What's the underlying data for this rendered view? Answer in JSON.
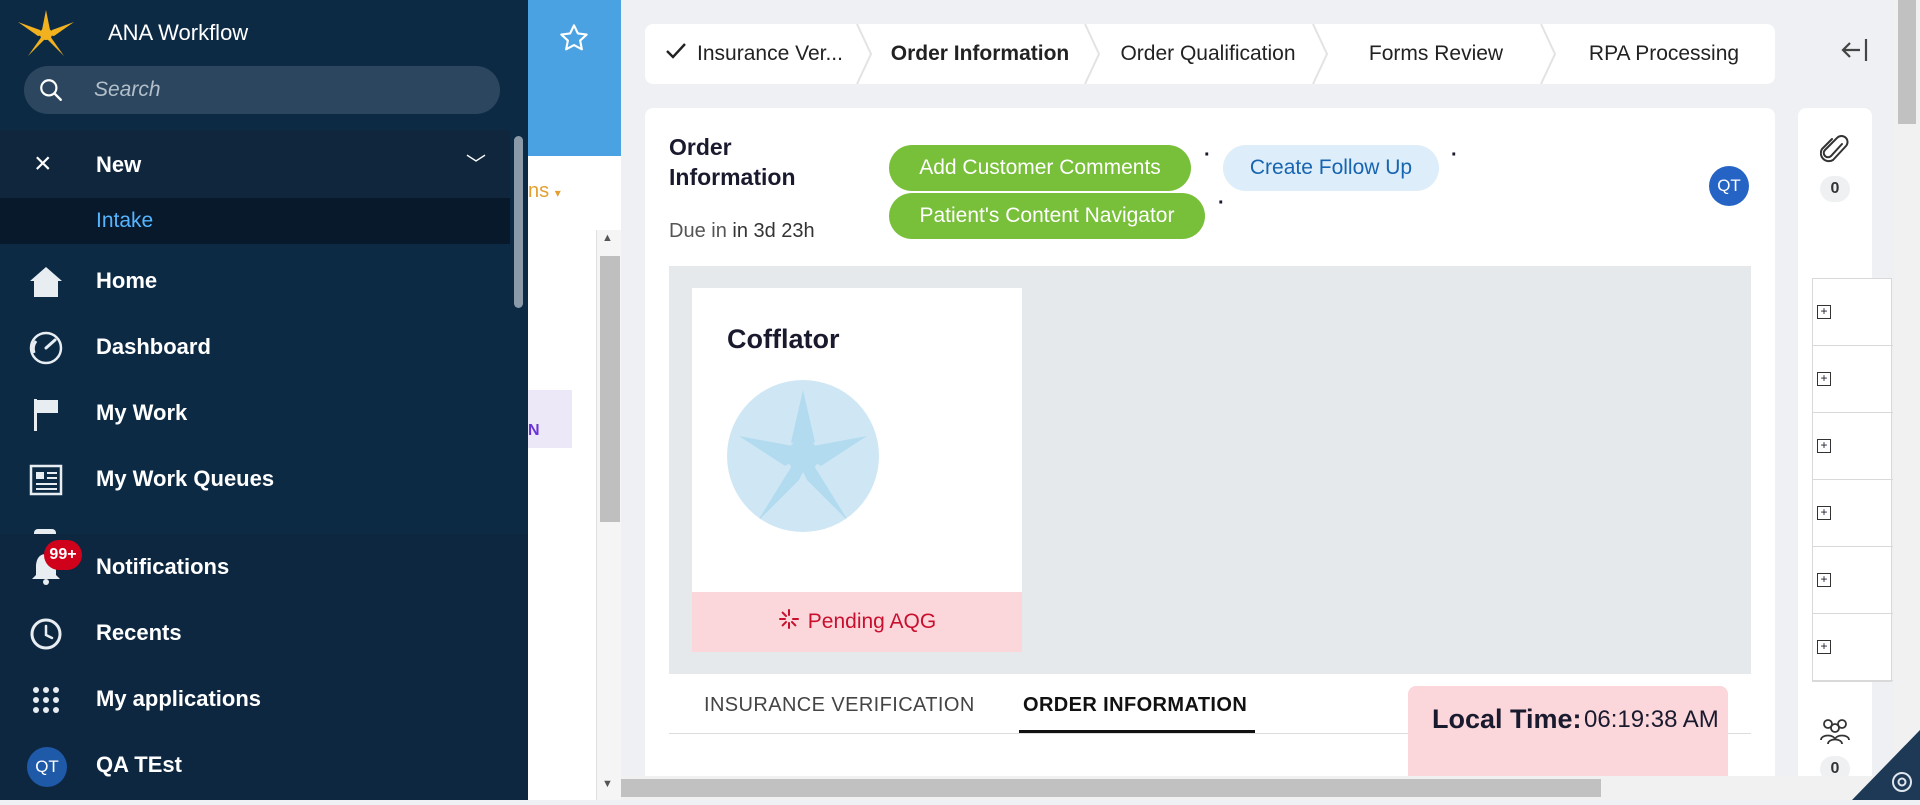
{
  "sidebar": {
    "app_name": "ANA Workflow",
    "search_placeholder": "Search",
    "new_section": {
      "label": "New",
      "items": [
        {
          "label": "Intake"
        }
      ]
    },
    "items": [
      {
        "label": "Home",
        "icon": "home-icon"
      },
      {
        "label": "Dashboard",
        "icon": "dashboard-gauge-icon"
      },
      {
        "label": "My Work",
        "icon": "flag-icon"
      },
      {
        "label": "My Work Queues",
        "icon": "queue-list-icon"
      }
    ],
    "bottom_items": [
      {
        "label": "Notifications",
        "icon": "bell-icon",
        "badge": "99+"
      },
      {
        "label": "Recents",
        "icon": "history-clock-icon"
      },
      {
        "label": "My applications",
        "icon": "apps-grid-icon"
      },
      {
        "label": "QA TEst",
        "avatar": "QT"
      }
    ]
  },
  "background": {
    "partial_text": "ns",
    "partial_tag": "N"
  },
  "stages": [
    {
      "label": "Insurance Ver...",
      "status": "completed"
    },
    {
      "label": "Order Information",
      "status": "active"
    },
    {
      "label": "Order Qualification",
      "status": "pending"
    },
    {
      "label": "Forms Review",
      "status": "pending"
    },
    {
      "label": "RPA Processing",
      "status": "pending"
    }
  ],
  "main": {
    "title": "Order Information",
    "due_label": "Due in",
    "due_value": "in 3d 23h",
    "actions": {
      "add_comments": "Add Customer Comments",
      "create_follow_up": "Create Follow Up",
      "content_navigator": "Patient's Content Navigator"
    },
    "assignee_avatar": "QT",
    "product": {
      "name": "Cofflator",
      "status": "Pending AQG"
    },
    "tabs": [
      {
        "label": "INSURANCE VERIFICATION",
        "active": false
      },
      {
        "label": "ORDER INFORMATION",
        "active": true
      }
    ]
  },
  "local_time": {
    "label": "Local Time:",
    "value": "06:19:38 AM"
  },
  "rail": {
    "attachments_count": "0",
    "participants_count": "0"
  },
  "colors": {
    "sidebar_bg": "#0d2a45",
    "accent_green": "#78bf3a",
    "accent_blue": "#2563c4",
    "pending_bg": "#fbd7dc",
    "pending_text": "#c8102e",
    "badge_red": "#d0021b"
  }
}
